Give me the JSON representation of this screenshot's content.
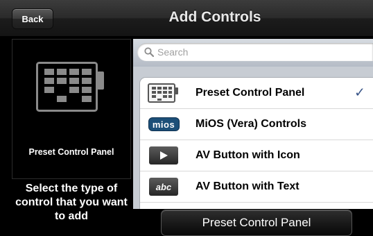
{
  "header": {
    "back_label": "Back",
    "title": "Add Controls"
  },
  "preview": {
    "icon": "keypad-icon",
    "label": "Preset Control Panel"
  },
  "help_text": "Select the type of control that you want to add",
  "search": {
    "placeholder": "Search",
    "icon": "search-icon"
  },
  "controls": [
    {
      "label": "Preset Control Panel",
      "icon": "keypad-icon",
      "selected": true
    },
    {
      "label": "MiOS (Vera) Controls",
      "icon": "mios-logo-icon",
      "icon_text": "mios"
    },
    {
      "label": "AV Button with Icon",
      "icon": "play-icon"
    },
    {
      "label": "AV Button with Text",
      "icon": "abc-text-icon",
      "icon_text": "abc"
    }
  ],
  "selected_check": "✓",
  "bottom_button": {
    "label": "Preset Control Panel"
  },
  "colors": {
    "checkmark": "#385487",
    "mios_badge": "#1c4f78",
    "list_bg": "#c7ccd3"
  }
}
